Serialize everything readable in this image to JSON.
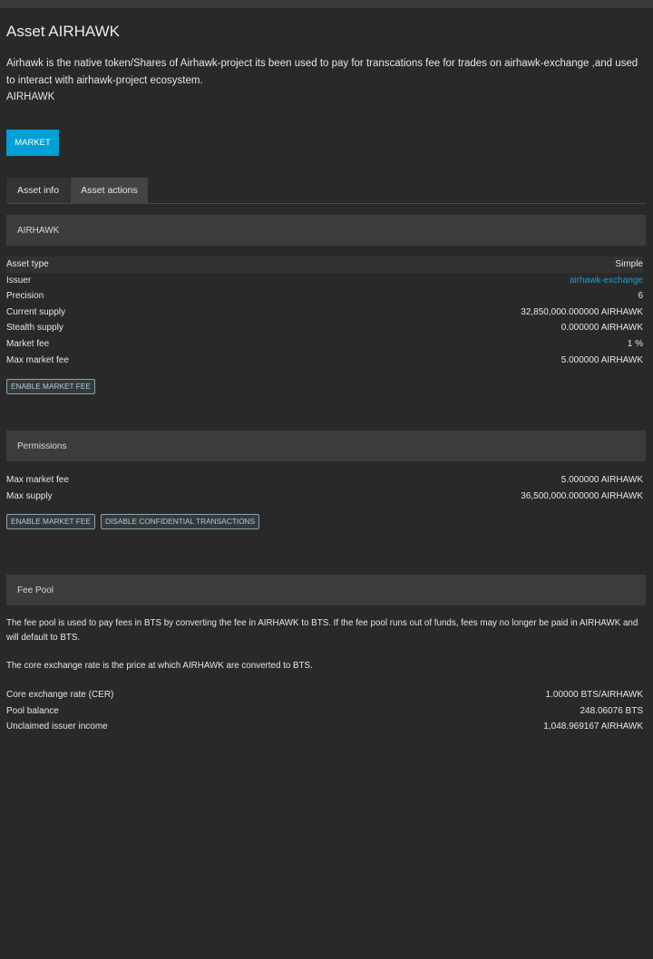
{
  "title": "Asset AIRHAWK",
  "description": "Airhawk is the native token/Shares of Airhawk-project its been used to pay for transcations fee for trades on airhawk-exchange ,and used to interact with airhawk-project ecosystem.",
  "symbol": "AIRHAWK",
  "market_button": "MARKET",
  "tabs": [
    "Asset info",
    "Asset actions"
  ],
  "asset_section": {
    "header": "AIRHAWK",
    "rows": [
      {
        "label": "Asset type",
        "value": "Simple"
      },
      {
        "label": "Issuer",
        "value": "airhawk-exchange"
      },
      {
        "label": "Precision",
        "value": "6"
      },
      {
        "label": "Current supply",
        "value": "32,850,000.000000 AIRHAWK"
      },
      {
        "label": "Stealth supply",
        "value": "0.000000 AIRHAWK"
      },
      {
        "label": "Market fee",
        "value": "1 %"
      },
      {
        "label": "Max market fee",
        "value": "5.000000 AIRHAWK"
      }
    ],
    "badge": "ENABLE MARKET FEE"
  },
  "permissions": {
    "header": "Permissions",
    "rows": [
      {
        "label": "Max market fee",
        "value": "5.000000 AIRHAWK"
      },
      {
        "label": "Max supply",
        "value": "36,500,000.000000 AIRHAWK"
      }
    ],
    "badges": [
      "ENABLE MARKET FEE",
      "DISABLE CONFIDENTIAL TRANSACTIONS"
    ]
  },
  "fee_pool": {
    "header": "Fee Pool",
    "para1": "The fee pool is used to pay fees in BTS by converting the fee in AIRHAWK to BTS. If the fee pool runs out of funds, fees may no longer be paid in AIRHAWK and will default to BTS.",
    "para2": "The core exchange rate is the price at which AIRHAWK are converted to BTS.",
    "rows": [
      {
        "label": "Core exchange rate (CER)",
        "value": "1.00000 BTS/AIRHAWK"
      },
      {
        "label": "Pool balance",
        "value": "248.06076 BTS"
      },
      {
        "label": "Unclaimed issuer income",
        "value": "1,048.969167 AIRHAWK"
      }
    ]
  },
  "colors": {
    "background": "#292929",
    "accent": "#00a0d6",
    "link": "#1a9ed8",
    "section_header": "#3c3c3c"
  }
}
